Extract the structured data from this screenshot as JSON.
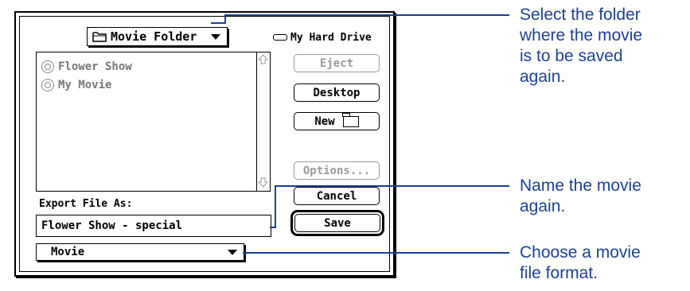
{
  "dialog": {
    "folder_popup_label": "Movie Folder",
    "drive_label": "My Hard Drive",
    "files": [
      {
        "name": "Flower Show"
      },
      {
        "name": "My Movie"
      }
    ],
    "buttons": {
      "eject": "Eject",
      "desktop": "Desktop",
      "new": "New",
      "options": "Options...",
      "cancel": "Cancel",
      "save": "Save"
    },
    "export_label": "Export File As:",
    "filename_value": "Flower Show - special",
    "format_value": "Movie"
  },
  "callouts": [
    {
      "line1": "Select the folder",
      "line2": "where the movie",
      "line3": "is to be saved",
      "line4": "again."
    },
    {
      "line1": "Name the movie",
      "line2": "again."
    },
    {
      "line1": "Choose a movie",
      "line2": "file format."
    }
  ],
  "colors": {
    "callout_text": "#1d3f93",
    "callout_line": "#1d3f93",
    "dim_text": "#999999"
  },
  "icons": {
    "folder": "folder-icon",
    "drive": "hard-drive-icon",
    "file": "movie-file-icon",
    "scroll_up": "scroll-up-arrow-icon",
    "scroll_down": "scroll-down-arrow-icon",
    "popup_arrow": "triangle-down-icon"
  }
}
